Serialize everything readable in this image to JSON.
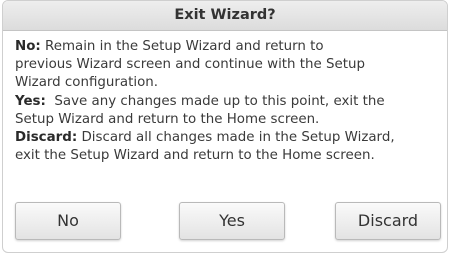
{
  "dialog": {
    "title": "Exit Wizard?",
    "options": [
      {
        "label": "No:",
        "text": " Remain in the Setup Wizard and return to",
        "lines": [
          "previous Wizard screen and continue with the Setup",
          "Wizard configuration."
        ]
      },
      {
        "label": "Yes:",
        "text": "  Save any changes made up to this point, exit the",
        "lines": [
          "Setup Wizard and return to the Home screen."
        ]
      },
      {
        "label": "Discard:",
        "text": " Discard all changes made in the Setup Wizard,",
        "lines": [
          "exit the Setup Wizard and return to the Home screen."
        ]
      }
    ],
    "buttons": {
      "no": "No",
      "yes": "Yes",
      "discard": "Discard"
    }
  }
}
